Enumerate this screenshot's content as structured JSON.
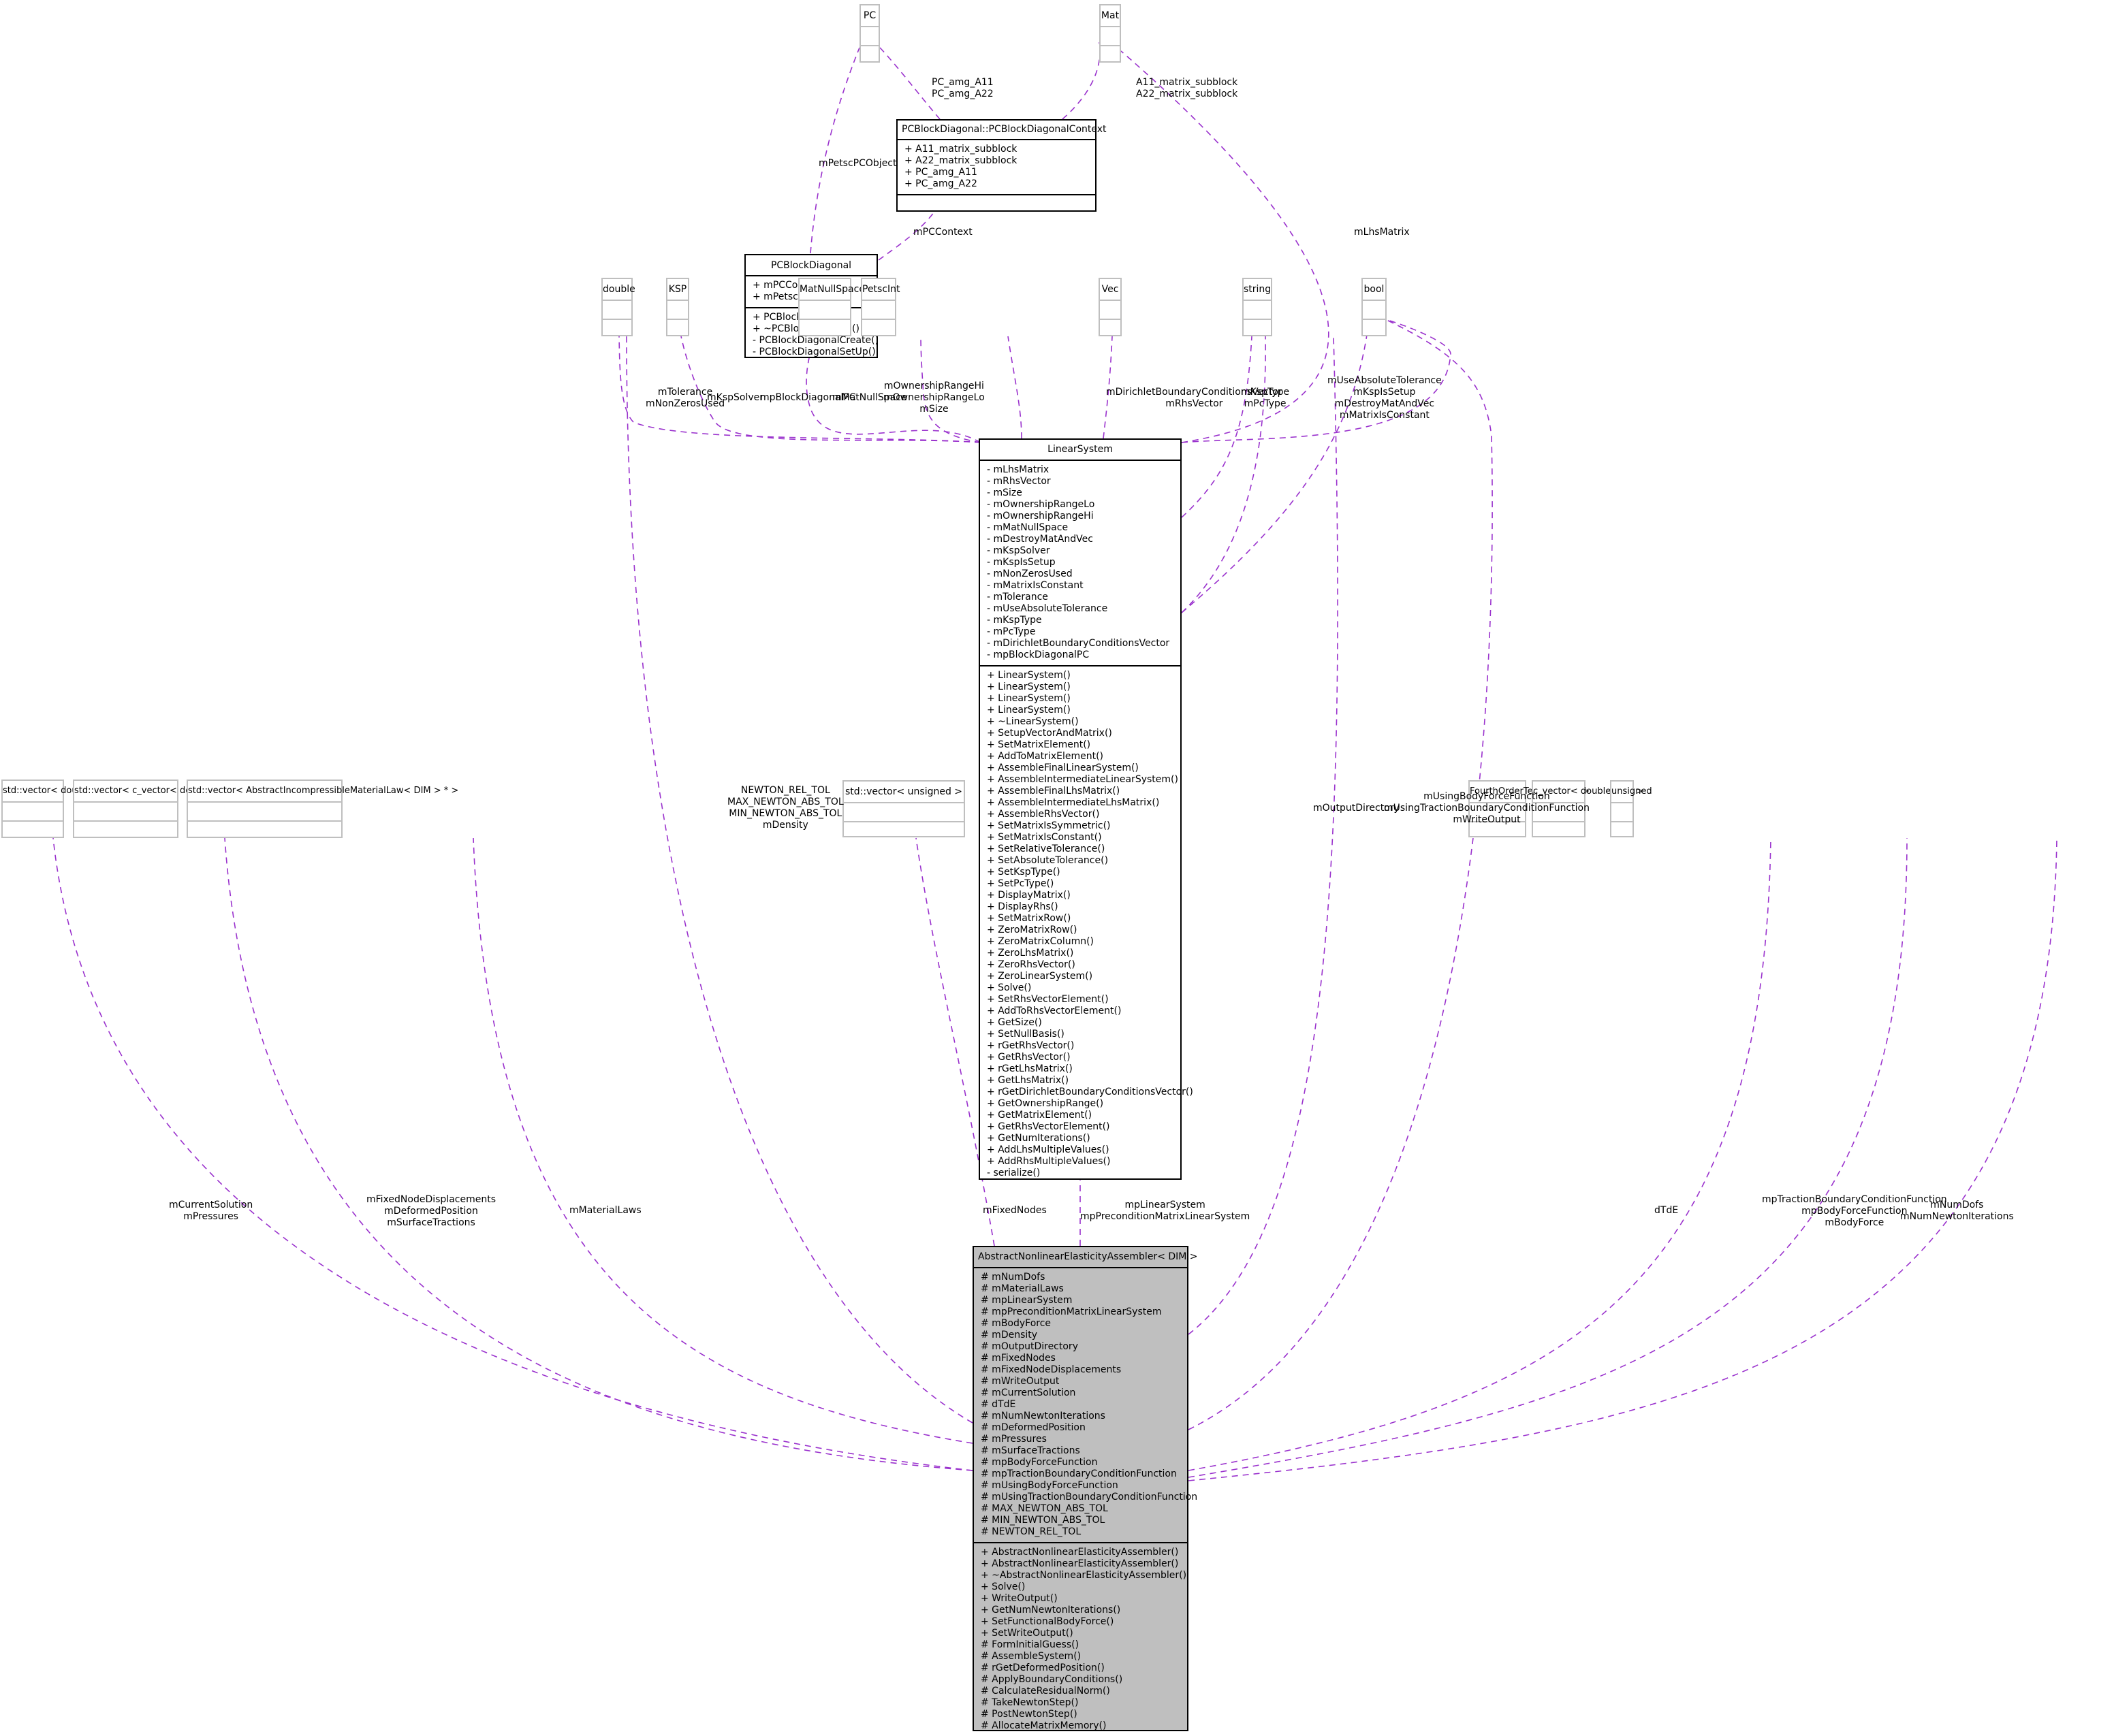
{
  "diagram": {
    "type": "collaboration-diagram",
    "edge_color": "#9a32cd",
    "classes": {
      "pc": {
        "name": "PC"
      },
      "mat": {
        "name": "Mat"
      },
      "pcContext": {
        "name": "PCBlockDiagonal::PCBlockDiagonalContext",
        "attributes": [
          "+ A11_matrix_subblock",
          "+ A22_matrix_subblock",
          "+ PC_amg_A11",
          "+ PC_amg_A22"
        ],
        "methods": []
      },
      "pcBlockDiagonal": {
        "name": "PCBlockDiagonal",
        "attributes": [
          "+ mPCContext",
          "+ mPetscPCObject"
        ],
        "methods": [
          "+ PCBlockDiagonal()",
          "+ ~PCBlockDiagonal()",
          "- PCBlockDiagonalCreate()",
          "- PCBlockDiagonalSetUp()"
        ]
      },
      "double": {
        "name": "double"
      },
      "ksp": {
        "name": "KSP"
      },
      "matNullSpace": {
        "name": "MatNullSpace"
      },
      "petscInt": {
        "name": "PetscInt"
      },
      "vec": {
        "name": "Vec"
      },
      "string": {
        "name": "string"
      },
      "bool": {
        "name": "bool"
      },
      "linearSystem": {
        "name": "LinearSystem",
        "attributes": [
          "- mLhsMatrix",
          "- mRhsVector",
          "- mSize",
          "- mOwnershipRangeLo",
          "- mOwnershipRangeHi",
          "- mMatNullSpace",
          "- mDestroyMatAndVec",
          "- mKspSolver",
          "- mKspIsSetup",
          "- mNonZerosUsed",
          "- mMatrixIsConstant",
          "- mTolerance",
          "- mUseAbsoluteTolerance",
          "- mKspType",
          "- mPcType",
          "- mDirichletBoundaryConditionsVector",
          "- mpBlockDiagonalPC"
        ],
        "methods": [
          "+ LinearSystem()",
          "+ LinearSystem()",
          "+ LinearSystem()",
          "+ LinearSystem()",
          "+ ~LinearSystem()",
          "+ SetupVectorAndMatrix()",
          "+ SetMatrixElement()",
          "+ AddToMatrixElement()",
          "+ AssembleFinalLinearSystem()",
          "+ AssembleIntermediateLinearSystem()",
          "+ AssembleFinalLhsMatrix()",
          "+ AssembleIntermediateLhsMatrix()",
          "+ AssembleRhsVector()",
          "+ SetMatrixIsSymmetric()",
          "+ SetMatrixIsConstant()",
          "+ SetRelativeTolerance()",
          "+ SetAbsoluteTolerance()",
          "+ SetKspType()",
          "+ SetPcType()",
          "+ DisplayMatrix()",
          "+ DisplayRhs()",
          "+ SetMatrixRow()",
          "+ ZeroMatrixRow()",
          "+ ZeroMatrixColumn()",
          "+ ZeroLhsMatrix()",
          "+ ZeroRhsVector()",
          "+ ZeroLinearSystem()",
          "+ Solve()",
          "+ SetRhsVectorElement()",
          "+ AddToRhsVectorElement()",
          "+ GetSize()",
          "+ SetNullBasis()",
          "+ rGetRhsVector()",
          "+ GetRhsVector()",
          "+ rGetLhsMatrix()",
          "+ GetLhsMatrix()",
          "+ rGetDirichletBoundaryConditionsVector()",
          "+ GetOwnershipRange()",
          "+ GetMatrixElement()",
          "+ GetRhsVectorElement()",
          "+ GetNumIterations()",
          "+ AddLhsMultipleValues()",
          "+ AddRhsMultipleValues()",
          "- serialize()"
        ]
      },
      "vecDouble": {
        "name": "std::vector< double >"
      },
      "vecCVector": {
        "name": "std::vector< c_vector< double, DIM > >"
      },
      "vecMatLaw": {
        "name": "std::vector< AbstractIncompressibleMaterialLaw< DIM > * >"
      },
      "vecUnsigned": {
        "name": "std::vector< unsigned >"
      },
      "fourthOrderTensor": {
        "name": "FourthOrderTensor< DIM >"
      },
      "cVector": {
        "name": "c_vector< double, DIM >"
      },
      "unsigned": {
        "name": "unsigned"
      },
      "assembler": {
        "name": "AbstractNonlinearElasticityAssembler< DIM >",
        "attributes": [
          "# mNumDofs",
          "# mMaterialLaws",
          "# mpLinearSystem",
          "# mpPreconditionMatrixLinearSystem",
          "# mBodyForce",
          "# mDensity",
          "# mOutputDirectory",
          "# mFixedNodes",
          "# mFixedNodeDisplacements",
          "# mWriteOutput",
          "# mCurrentSolution",
          "# dTdE",
          "# mNumNewtonIterations",
          "# mDeformedPosition",
          "# mPressures",
          "# mSurfaceTractions",
          "# mpBodyForceFunction",
          "# mpTractionBoundaryConditionFunction",
          "# mUsingBodyForceFunction",
          "# mUsingTractionBoundaryConditionFunction",
          "# MAX_NEWTON_ABS_TOL",
          "# MIN_NEWTON_ABS_TOL",
          "# NEWTON_REL_TOL"
        ],
        "methods": [
          "+ AbstractNonlinearElasticityAssembler()",
          "+ AbstractNonlinearElasticityAssembler()",
          "+ ~AbstractNonlinearElasticityAssembler()",
          "+ Solve()",
          "+ WriteOutput()",
          "+ GetNumNewtonIterations()",
          "+ SetFunctionalBodyForce()",
          "+ SetWriteOutput()",
          "# FormInitialGuess()",
          "# AssembleSystem()",
          "# rGetDeformedPosition()",
          "# ApplyBoundaryConditions()",
          "# CalculateResidualNorm()",
          "# TakeNewtonStep()",
          "# PostNewtonStep()",
          "# AllocateMatrixMemory()"
        ]
      }
    },
    "edge_labels": {
      "pcAmg": [
        "PC_amg_A11",
        "PC_amg_A22"
      ],
      "matSub": [
        "A11_matrix_subblock",
        "A22_matrix_subblock"
      ],
      "petscPC": [
        "mPetscPCObject"
      ],
      "pcContext": [
        "mPCContext"
      ],
      "lhsMatrix": [
        "mLhsMatrix"
      ],
      "doubleLS": [
        "mTolerance",
        "mNonZerosUsed"
      ],
      "kspSolver": [
        "mKspSolver"
      ],
      "blockDiag": [
        "mpBlockDiagonalPC"
      ],
      "matNull": [
        "mMatNullSpace"
      ],
      "petscInt": [
        "mOwnershipRangeHi",
        "mOwnershipRangeLo",
        "mSize"
      ],
      "vec": [
        "mDirichletBoundaryConditionsVector",
        "mRhsVector"
      ],
      "string": [
        "mKspType",
        "mPcType"
      ],
      "bool": [
        "mUseAbsoluteTolerance",
        "mKspIsSetup",
        "mDestroyMatAndVec",
        "mMatrixIsConstant"
      ],
      "newtonTol": [
        "NEWTON_REL_TOL",
        "MAX_NEWTON_ABS_TOL",
        "MIN_NEWTON_ABS_TOL",
        "mDensity"
      ],
      "outputDir": [
        "mOutputDirectory"
      ],
      "usingFns": [
        "mUsingBodyForceFunction",
        "mUsingTractionBoundaryConditionFunction",
        "mWriteOutput"
      ],
      "currentSol": [
        "mCurrentSolution",
        "mPressures"
      ],
      "fixedDisp": [
        "mFixedNodeDisplacements",
        "mDeformedPosition",
        "mSurfaceTractions"
      ],
      "materialLaws": [
        "mMaterialLaws"
      ],
      "fixedNodes": [
        "mFixedNodes"
      ],
      "linSys": [
        "mpLinearSystem",
        "mpPreconditionMatrixLinearSystem"
      ],
      "dTdE": [
        "dTdE"
      ],
      "traction": [
        "mpTractionBoundaryConditionFunction",
        "mpBodyForceFunction",
        "mBodyForce"
      ],
      "numDofs": [
        "mNumDofs",
        "mNumNewtonIterations"
      ]
    }
  }
}
